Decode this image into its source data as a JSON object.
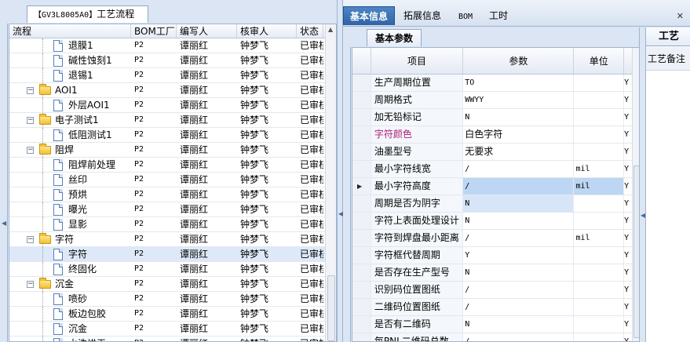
{
  "left_panel": {
    "title_code": "【GV3L8005A0】",
    "title_text": "工艺流程",
    "columns": {
      "flow": "流程",
      "bom": "BOM工厂",
      "editor": "编写人",
      "reviewer": "核审人",
      "status": "状态"
    },
    "rows": [
      {
        "label": "退膜1",
        "level": 2,
        "type": "doc",
        "bom": "P2",
        "editor": "谭丽红",
        "reviewer": "钟梦飞",
        "status": "已审核"
      },
      {
        "label": "碱性蚀刻1",
        "level": 2,
        "type": "doc",
        "bom": "P2",
        "editor": "谭丽红",
        "reviewer": "钟梦飞",
        "status": "已审核"
      },
      {
        "label": "退锡1",
        "level": 2,
        "type": "doc",
        "bom": "P2",
        "editor": "谭丽红",
        "reviewer": "钟梦飞",
        "status": "已审核"
      },
      {
        "label": "AOI1",
        "level": 1,
        "type": "folder",
        "bom": "P2",
        "editor": "谭丽红",
        "reviewer": "钟梦飞",
        "status": "已审核"
      },
      {
        "label": "外层AOI1",
        "level": 2,
        "type": "doc",
        "bom": "P2",
        "editor": "谭丽红",
        "reviewer": "钟梦飞",
        "status": "已审核"
      },
      {
        "label": "电子测试1",
        "level": 1,
        "type": "folder",
        "bom": "P2",
        "editor": "谭丽红",
        "reviewer": "钟梦飞",
        "status": "已审核"
      },
      {
        "label": "低阻测试1",
        "level": 2,
        "type": "doc",
        "bom": "P2",
        "editor": "谭丽红",
        "reviewer": "钟梦飞",
        "status": "已审核"
      },
      {
        "label": "阻焊",
        "level": 1,
        "type": "folder",
        "bom": "P2",
        "editor": "谭丽红",
        "reviewer": "钟梦飞",
        "status": "已审核"
      },
      {
        "label": "阻焊前处理",
        "level": 2,
        "type": "doc",
        "bom": "P2",
        "editor": "谭丽红",
        "reviewer": "钟梦飞",
        "status": "已审核"
      },
      {
        "label": "丝印",
        "level": 2,
        "type": "doc",
        "bom": "P2",
        "editor": "谭丽红",
        "reviewer": "钟梦飞",
        "status": "已审核"
      },
      {
        "label": "预烘",
        "level": 2,
        "type": "doc",
        "bom": "P2",
        "editor": "谭丽红",
        "reviewer": "钟梦飞",
        "status": "已审核"
      },
      {
        "label": "曝光",
        "level": 2,
        "type": "doc",
        "bom": "P2",
        "editor": "谭丽红",
        "reviewer": "钟梦飞",
        "status": "已审核"
      },
      {
        "label": "显影",
        "level": 2,
        "type": "doc",
        "bom": "P2",
        "editor": "谭丽红",
        "reviewer": "钟梦飞",
        "status": "已审核"
      },
      {
        "label": "字符",
        "level": 1,
        "type": "folder",
        "bom": "P2",
        "editor": "谭丽红",
        "reviewer": "钟梦飞",
        "status": "已审核"
      },
      {
        "label": "字符",
        "level": 2,
        "type": "doc",
        "bom": "P2",
        "editor": "谭丽红",
        "reviewer": "钟梦飞",
        "status": "已审核",
        "selected": true
      },
      {
        "label": "终固化",
        "level": 2,
        "type": "doc",
        "bom": "P2",
        "editor": "谭丽红",
        "reviewer": "钟梦飞",
        "status": "已审核"
      },
      {
        "label": "沉金",
        "level": 1,
        "type": "folder",
        "bom": "P2",
        "editor": "谭丽红",
        "reviewer": "钟梦飞",
        "status": "已审核"
      },
      {
        "label": "喷砂",
        "level": 2,
        "type": "doc",
        "bom": "P2",
        "editor": "谭丽红",
        "reviewer": "钟梦飞",
        "status": "已审核"
      },
      {
        "label": "板边包胶",
        "level": 2,
        "type": "doc",
        "bom": "P2",
        "editor": "谭丽红",
        "reviewer": "钟梦飞",
        "status": "已审核"
      },
      {
        "label": "沉金",
        "level": 2,
        "type": "doc",
        "bom": "P2",
        "editor": "谭丽红",
        "reviewer": "钟梦飞",
        "status": "已审核"
      },
      {
        "label": "水洗烘干",
        "level": 2,
        "type": "doc",
        "bom": "P2",
        "editor": "谭丽红",
        "reviewer": "钟梦飞",
        "status": "已审核"
      }
    ]
  },
  "right_panel": {
    "tabs": [
      "基本信息",
      "拓展信息",
      "BOM",
      "工时"
    ],
    "active_tab": 0,
    "sub_tab": "基本参数",
    "remark_tab": "工艺",
    "remark_label": "工艺备注",
    "param_columns": {
      "item": "项目",
      "value": "参数",
      "unit": "单位"
    },
    "params": [
      {
        "item": "生产周期位置",
        "value": "TO",
        "unit": "",
        "extra": "Y"
      },
      {
        "item": "周期格式",
        "value": "WWYY",
        "unit": "",
        "extra": "Y"
      },
      {
        "item": "加无铅标记",
        "value": "N",
        "unit": "",
        "extra": "Y"
      },
      {
        "item": "字符颜色",
        "value": "白色字符",
        "unit": "",
        "extra": "Y",
        "highlight": true
      },
      {
        "item": "油墨型号",
        "value": "无要求",
        "unit": "",
        "extra": "Y"
      },
      {
        "item": "最小字符线宽",
        "value": "/",
        "unit": "mil",
        "extra": "Y"
      },
      {
        "item": "最小字符高度",
        "value": "/",
        "unit": "mil",
        "extra": "Y",
        "current": true
      },
      {
        "item": "周期是否为阴字",
        "value": "N",
        "unit": "",
        "extra": "Y",
        "next_sel": true
      },
      {
        "item": "字符上表面处理设计",
        "value": "N",
        "unit": "",
        "extra": "Y"
      },
      {
        "item": "字符到焊盘最小距离",
        "value": "/",
        "unit": "mil",
        "extra": "Y"
      },
      {
        "item": "字符框代替周期",
        "value": "Y",
        "unit": "",
        "extra": "Y"
      },
      {
        "item": "是否存在生产型号",
        "value": "N",
        "unit": "",
        "extra": "Y"
      },
      {
        "item": "识别码位置图纸",
        "value": "/",
        "unit": "",
        "extra": "Y"
      },
      {
        "item": "二维码位置图纸",
        "value": "/",
        "unit": "",
        "extra": "Y"
      },
      {
        "item": "是否有二维码",
        "value": "N",
        "unit": "",
        "extra": "Y"
      },
      {
        "item": "每PNL二维码总数",
        "value": "/",
        "unit": "",
        "extra": "Y"
      }
    ]
  },
  "colors": {
    "active_tab": "#2f63a6",
    "selected_row": "#bcd6f3",
    "magenta_item": "#b0207a",
    "panel_bg": "#dbe5f3"
  },
  "icons": {
    "folder": "folder-icon",
    "doc": "document-icon",
    "collapse": "collapse-toggle-icon"
  }
}
